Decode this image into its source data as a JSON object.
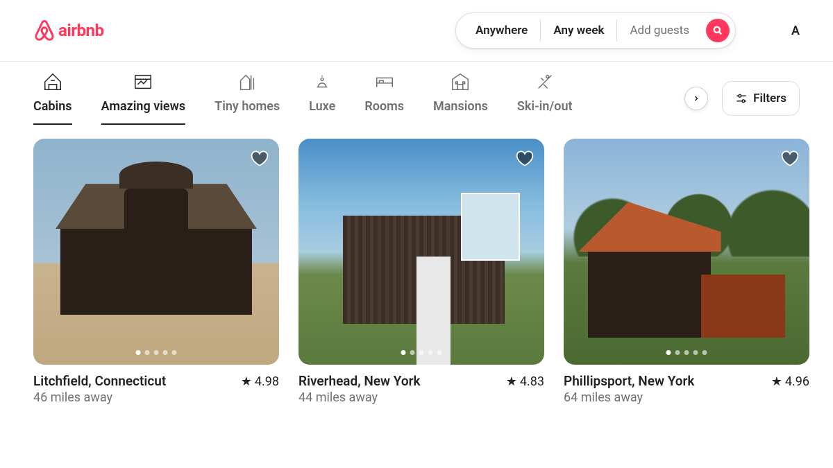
{
  "brand": {
    "name": "airbnb",
    "color": "#FF385C"
  },
  "search": {
    "where": "Anywhere",
    "when": "Any week",
    "guests": "Add guests"
  },
  "nav_right_initial": "A",
  "categories": [
    {
      "id": "cabins",
      "label": "Cabins",
      "icon": "cabin",
      "active": true
    },
    {
      "id": "amazing-views",
      "label": "Amazing views",
      "icon": "window",
      "active": true
    },
    {
      "id": "tiny-homes",
      "label": "Tiny homes",
      "icon": "tiny-home",
      "active": false
    },
    {
      "id": "luxe",
      "label": "Luxe",
      "icon": "luxe",
      "active": false
    },
    {
      "id": "rooms",
      "label": "Rooms",
      "icon": "bed",
      "active": false
    },
    {
      "id": "mansions",
      "label": "Mansions",
      "icon": "mansion",
      "active": false
    },
    {
      "id": "ski",
      "label": "Ski-in/out",
      "icon": "ski",
      "active": false
    }
  ],
  "filters_label": "Filters",
  "listings": [
    {
      "location": "Litchfield, Connecticut",
      "distance": "46 miles away",
      "rating": "4.98"
    },
    {
      "location": "Riverhead, New York",
      "distance": "44 miles away",
      "rating": "4.83"
    },
    {
      "location": "Phillipsport, New York",
      "distance": "64 miles away",
      "rating": "4.96"
    }
  ]
}
